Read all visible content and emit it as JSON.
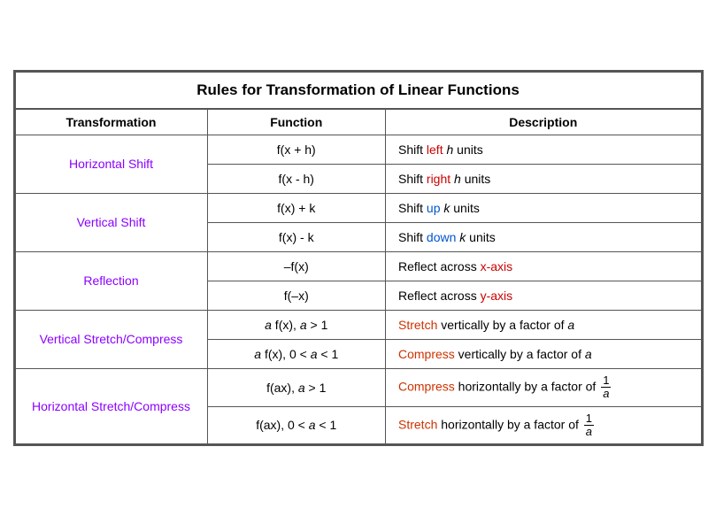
{
  "title": "Rules for Transformation of Linear Functions",
  "headers": [
    "Transformation",
    "Function",
    "Description"
  ],
  "rows": [
    {
      "transform": "Horizontal Shift",
      "transform_color": "purple",
      "sub_rows": [
        {
          "function": "f(x + h)",
          "desc_parts": [
            {
              "text": "Shift "
            },
            {
              "text": "left",
              "color": "red"
            },
            {
              "text": " "
            },
            {
              "text": "h",
              "italic": true
            },
            {
              "text": " units"
            }
          ]
        },
        {
          "function": "f(x  - h)",
          "desc_parts": [
            {
              "text": "Shift "
            },
            {
              "text": "right",
              "color": "red"
            },
            {
              "text": " "
            },
            {
              "text": "h",
              "italic": true
            },
            {
              "text": " units"
            }
          ]
        }
      ]
    },
    {
      "transform": "Vertical Shift",
      "transform_color": "purple",
      "sub_rows": [
        {
          "function": "f(x) + k",
          "desc_parts": [
            {
              "text": "Shift "
            },
            {
              "text": "up",
              "color": "blue"
            },
            {
              "text": " "
            },
            {
              "text": "k",
              "italic": true
            },
            {
              "text": " units"
            }
          ]
        },
        {
          "function": "f(x) - k",
          "desc_parts": [
            {
              "text": "Shift "
            },
            {
              "text": "down",
              "color": "blue"
            },
            {
              "text": " "
            },
            {
              "text": "k",
              "italic": true
            },
            {
              "text": " units"
            }
          ]
        }
      ]
    },
    {
      "transform": "Reflection",
      "transform_color": "purple",
      "sub_rows": [
        {
          "function": "–f(x)",
          "desc_parts": [
            {
              "text": "Reflect across "
            },
            {
              "text": "x-axis",
              "color": "red"
            }
          ]
        },
        {
          "function": "f(–x)",
          "desc_parts": [
            {
              "text": "Reflect across "
            },
            {
              "text": "y-axis",
              "color": "red"
            }
          ]
        }
      ]
    },
    {
      "transform": "Vertical Stretch/Compress",
      "transform_color": "purple",
      "sub_rows": [
        {
          "function": "a f(x), a > 1",
          "desc_parts": [
            {
              "text": "Stretch",
              "color": "orangered"
            },
            {
              "text": " vertically by a factor of "
            },
            {
              "text": "a",
              "italic": true
            }
          ]
        },
        {
          "function": "a f(x), 0 < a < 1",
          "desc_parts": [
            {
              "text": "Compress",
              "color": "orangered"
            },
            {
              "text": " vertically by a factor of "
            },
            {
              "text": "a",
              "italic": true
            }
          ]
        }
      ]
    },
    {
      "transform": "Horizontal Stretch/Compress",
      "transform_color": "purple",
      "sub_rows": [
        {
          "function": "f(ax), a > 1",
          "complex_desc": "compress_h"
        },
        {
          "function": "f(ax), 0 < a < 1",
          "complex_desc": "stretch_h"
        }
      ]
    }
  ]
}
